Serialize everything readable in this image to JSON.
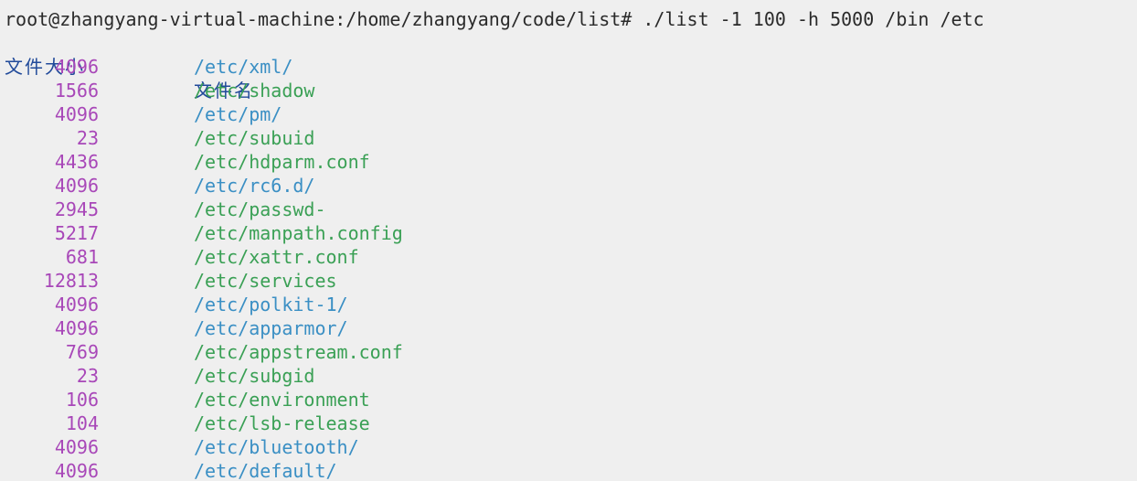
{
  "terminal": {
    "prompt": "root@zhangyang-virtual-machine:/home/zhangyang/code/list# ",
    "command": "./list -1 100 -h 5000 /bin /etc",
    "headers": {
      "size": "文件大小",
      "name": "文件名"
    },
    "rows": [
      {
        "size": "4096",
        "name": "/etc/xml/",
        "kind": "dir"
      },
      {
        "size": "1566",
        "name": "/etc/shadow",
        "kind": "file"
      },
      {
        "size": "4096",
        "name": "/etc/pm/",
        "kind": "dir"
      },
      {
        "size": "23",
        "name": "/etc/subuid",
        "kind": "file"
      },
      {
        "size": "4436",
        "name": "/etc/hdparm.conf",
        "kind": "file"
      },
      {
        "size": "4096",
        "name": "/etc/rc6.d/",
        "kind": "dir"
      },
      {
        "size": "2945",
        "name": "/etc/passwd-",
        "kind": "file"
      },
      {
        "size": "5217",
        "name": "/etc/manpath.config",
        "kind": "file"
      },
      {
        "size": "681",
        "name": "/etc/xattr.conf",
        "kind": "file"
      },
      {
        "size": "12813",
        "name": "/etc/services",
        "kind": "file"
      },
      {
        "size": "4096",
        "name": "/etc/polkit-1/",
        "kind": "dir"
      },
      {
        "size": "4096",
        "name": "/etc/apparmor/",
        "kind": "dir"
      },
      {
        "size": "769",
        "name": "/etc/appstream.conf",
        "kind": "file"
      },
      {
        "size": "23",
        "name": "/etc/subgid",
        "kind": "file"
      },
      {
        "size": "106",
        "name": "/etc/environment",
        "kind": "file"
      },
      {
        "size": "104",
        "name": "/etc/lsb-release",
        "kind": "file"
      },
      {
        "size": "4096",
        "name": "/etc/bluetooth/",
        "kind": "dir"
      },
      {
        "size": "4096",
        "name": "/etc/default/",
        "kind": "dir"
      }
    ]
  },
  "colors": {
    "background": "#efefef",
    "size": "#a847b8",
    "directory": "#3a8fc4",
    "file": "#3aa055",
    "header": "#214a9a"
  }
}
